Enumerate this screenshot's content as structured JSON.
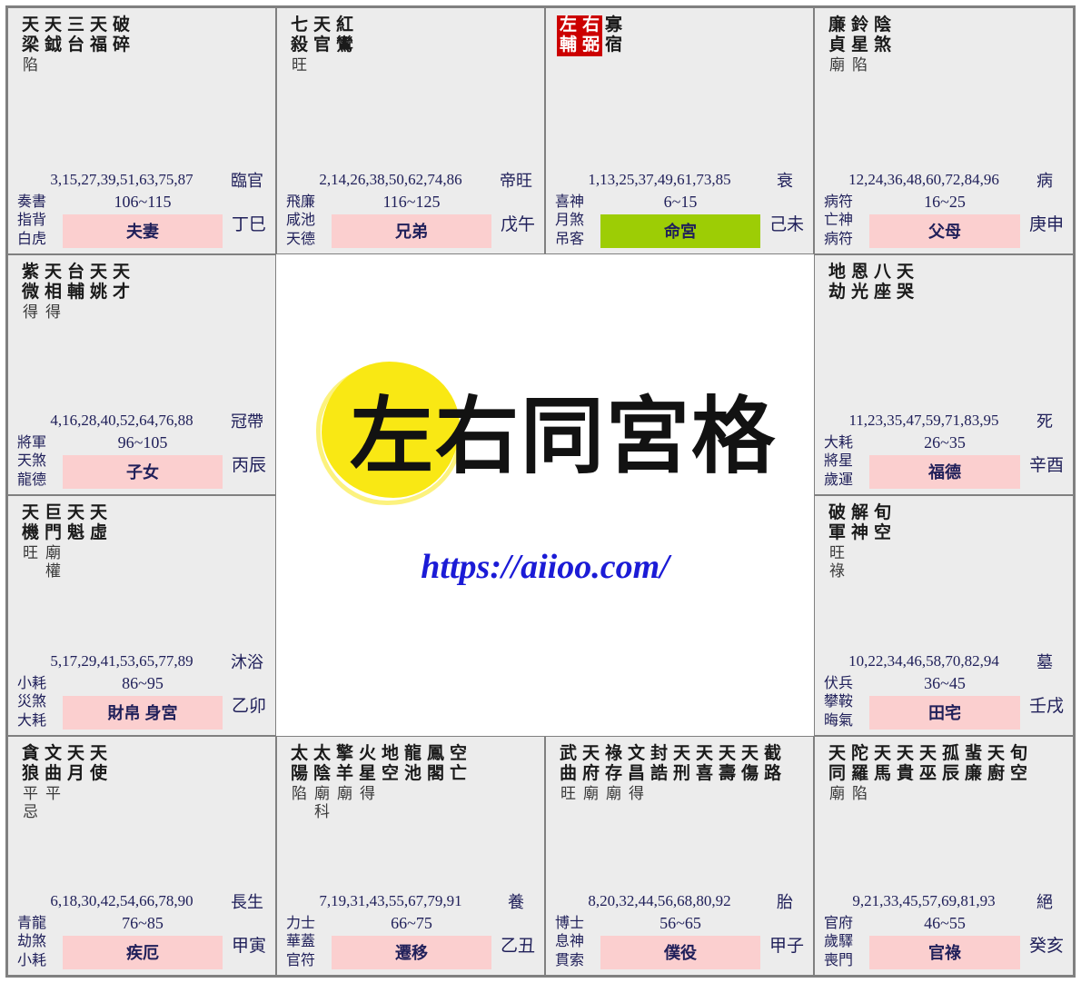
{
  "center": {
    "watermark_text": "左右同宮格",
    "watermark_highlight_char": "左",
    "site_url": "https://aiioo.com/",
    "brush_color": "#f9e814",
    "url_color": "#1b1bd6"
  },
  "theme": {
    "cell_bg": "#ececec",
    "border": "#808080",
    "badge_pink": "#fbcfcf",
    "badge_green": "#9dcd05",
    "star_highlight_red": "#cc0000",
    "text_navy": "#20205a"
  },
  "palaces": [
    {
      "id": "si",
      "grid": {
        "col": 0,
        "row": 0
      },
      "stars": [
        {
          "name": "天梁",
          "highlight": false
        },
        {
          "name": "天鉞",
          "highlight": false
        },
        {
          "name": "三台",
          "highlight": false
        },
        {
          "name": "天福",
          "highlight": false
        },
        {
          "name": "破碎",
          "highlight": false
        }
      ],
      "brightness": [
        "陷"
      ],
      "transforms": [],
      "ages": "3,15,27,39,51,63,75,87",
      "stage": "臨官",
      "gods": [
        "奏書",
        "指背",
        "白虎"
      ],
      "decade": "106~115",
      "palace_name": "夫妻",
      "is_life_palace": false,
      "branch": "丁巳"
    },
    {
      "id": "wu",
      "grid": {
        "col": 1,
        "row": 0
      },
      "stars": [
        {
          "name": "七殺",
          "highlight": false
        },
        {
          "name": "天官",
          "highlight": false
        },
        {
          "name": "紅鸞",
          "highlight": false
        }
      ],
      "brightness": [
        "旺"
      ],
      "transforms": [],
      "ages": "2,14,26,38,50,62,74,86",
      "stage": "帝旺",
      "gods": [
        "飛廉",
        "咸池",
        "天德"
      ],
      "decade": "116~125",
      "palace_name": "兄弟",
      "is_life_palace": false,
      "branch": "戊午"
    },
    {
      "id": "wei",
      "grid": {
        "col": 2,
        "row": 0
      },
      "stars": [
        {
          "name": "左輔",
          "highlight": true
        },
        {
          "name": "右弼",
          "highlight": true
        },
        {
          "name": "寡宿",
          "highlight": false
        }
      ],
      "brightness": [],
      "transforms": [],
      "ages": "1,13,25,37,49,61,73,85",
      "stage": "衰",
      "gods": [
        "喜神",
        "月煞",
        "吊客"
      ],
      "decade": "6~15",
      "palace_name": "命宮",
      "is_life_palace": true,
      "branch": "己未"
    },
    {
      "id": "shen",
      "grid": {
        "col": 3,
        "row": 0
      },
      "stars": [
        {
          "name": "廉貞",
          "highlight": false
        },
        {
          "name": "鈴星",
          "highlight": false
        },
        {
          "name": "陰煞",
          "highlight": false
        }
      ],
      "brightness": [
        "廟",
        "陷"
      ],
      "transforms": [],
      "ages": "12,24,36,48,60,72,84,96",
      "stage": "病",
      "gods": [
        "病符",
        "亡神",
        "病符"
      ],
      "decade": "16~25",
      "palace_name": "父母",
      "is_life_palace": false,
      "branch": "庚申"
    },
    {
      "id": "chen",
      "grid": {
        "col": 0,
        "row": 1
      },
      "stars": [
        {
          "name": "紫微",
          "highlight": false
        },
        {
          "name": "天相",
          "highlight": false
        },
        {
          "name": "台輔",
          "highlight": false
        },
        {
          "name": "天姚",
          "highlight": false
        },
        {
          "name": "天才",
          "highlight": false
        }
      ],
      "brightness": [
        "得",
        "得"
      ],
      "transforms": [],
      "ages": "4,16,28,40,52,64,76,88",
      "stage": "冠帶",
      "gods": [
        "將軍",
        "天煞",
        "龍德"
      ],
      "decade": "96~105",
      "palace_name": "子女",
      "is_life_palace": false,
      "branch": "丙辰"
    },
    {
      "id": "you",
      "grid": {
        "col": 3,
        "row": 1
      },
      "stars": [
        {
          "name": "地劫",
          "highlight": false
        },
        {
          "name": "恩光",
          "highlight": false
        },
        {
          "name": "八座",
          "highlight": false
        },
        {
          "name": "天哭",
          "highlight": false
        }
      ],
      "brightness": [],
      "transforms": [],
      "ages": "11,23,35,47,59,71,83,95",
      "stage": "死",
      "gods": [
        "大耗",
        "將星",
        "歲運"
      ],
      "decade": "26~35",
      "palace_name": "福德",
      "is_life_palace": false,
      "branch": "辛酉"
    },
    {
      "id": "mao",
      "grid": {
        "col": 0,
        "row": 2
      },
      "stars": [
        {
          "name": "天機",
          "highlight": false
        },
        {
          "name": "巨門",
          "highlight": false
        },
        {
          "name": "天魁",
          "highlight": false
        },
        {
          "name": "天虛",
          "highlight": false
        }
      ],
      "brightness": [
        "旺",
        "廟"
      ],
      "transforms": [
        "",
        "權"
      ],
      "ages": "5,17,29,41,53,65,77,89",
      "stage": "沐浴",
      "gods": [
        "小耗",
        "災煞",
        "大耗"
      ],
      "decade": "86~95",
      "palace_name": "財帛 身宮",
      "is_life_palace": false,
      "branch": "乙卯"
    },
    {
      "id": "xu",
      "grid": {
        "col": 3,
        "row": 2
      },
      "stars": [
        {
          "name": "破軍",
          "highlight": false
        },
        {
          "name": "解神",
          "highlight": false
        },
        {
          "name": "旬空",
          "highlight": false
        }
      ],
      "brightness": [
        "旺"
      ],
      "transforms": [
        "祿"
      ],
      "ages": "10,22,34,46,58,70,82,94",
      "stage": "墓",
      "gods": [
        "伏兵",
        "攀鞍",
        "晦氣"
      ],
      "decade": "36~45",
      "palace_name": "田宅",
      "is_life_palace": false,
      "branch": "壬戌"
    },
    {
      "id": "yin",
      "grid": {
        "col": 0,
        "row": 3
      },
      "stars": [
        {
          "name": "貪狼",
          "highlight": false
        },
        {
          "name": "文曲",
          "highlight": false
        },
        {
          "name": "天月",
          "highlight": false
        },
        {
          "name": "天使",
          "highlight": false
        }
      ],
      "brightness": [
        "平",
        "平"
      ],
      "transforms": [
        "忌"
      ],
      "ages": "6,18,30,42,54,66,78,90",
      "stage": "長生",
      "gods": [
        "青龍",
        "劫煞",
        "小耗"
      ],
      "decade": "76~85",
      "palace_name": "疾厄",
      "is_life_palace": false,
      "branch": "甲寅"
    },
    {
      "id": "chou",
      "grid": {
        "col": 1,
        "row": 3
      },
      "stars": [
        {
          "name": "太陽",
          "highlight": false
        },
        {
          "name": "太陰",
          "highlight": false
        },
        {
          "name": "擎羊",
          "highlight": false
        },
        {
          "name": "火星",
          "highlight": false
        },
        {
          "name": "地空",
          "highlight": false
        },
        {
          "name": "龍池",
          "highlight": false
        },
        {
          "name": "鳳閣",
          "highlight": false
        },
        {
          "name": "空亡",
          "highlight": false
        }
      ],
      "brightness": [
        "陷",
        "廟",
        "廟",
        "得"
      ],
      "transforms": [
        "",
        "科"
      ],
      "ages": "7,19,31,43,55,67,79,91",
      "stage": "養",
      "gods": [
        "力士",
        "華蓋",
        "官符"
      ],
      "decade": "66~75",
      "palace_name": "遷移",
      "is_life_palace": false,
      "branch": "乙丑"
    },
    {
      "id": "zi",
      "grid": {
        "col": 2,
        "row": 3
      },
      "stars": [
        {
          "name": "武曲",
          "highlight": false
        },
        {
          "name": "天府",
          "highlight": false
        },
        {
          "name": "祿存",
          "highlight": false
        },
        {
          "name": "文昌",
          "highlight": false
        },
        {
          "name": "封誥",
          "highlight": false
        },
        {
          "name": "天刑",
          "highlight": false
        },
        {
          "name": "天喜",
          "highlight": false
        },
        {
          "name": "天壽",
          "highlight": false
        },
        {
          "name": "天傷",
          "highlight": false
        },
        {
          "name": "截路",
          "highlight": false
        }
      ],
      "brightness": [
        "旺",
        "廟",
        "廟",
        "得"
      ],
      "transforms": [],
      "ages": "8,20,32,44,56,68,80,92",
      "stage": "胎",
      "gods": [
        "博士",
        "息神",
        "貫索"
      ],
      "decade": "56~65",
      "palace_name": "僕役",
      "is_life_palace": false,
      "branch": "甲子"
    },
    {
      "id": "hai",
      "grid": {
        "col": 3,
        "row": 3
      },
      "stars": [
        {
          "name": "天同",
          "highlight": false
        },
        {
          "name": "陀羅",
          "highlight": false
        },
        {
          "name": "天馬",
          "highlight": false
        },
        {
          "name": "天貴",
          "highlight": false
        },
        {
          "name": "天巫",
          "highlight": false
        },
        {
          "name": "孤辰",
          "highlight": false
        },
        {
          "name": "蜚廉",
          "highlight": false
        },
        {
          "name": "天廚",
          "highlight": false
        },
        {
          "name": "旬空",
          "highlight": false
        }
      ],
      "brightness": [
        "廟",
        "陷"
      ],
      "transforms": [],
      "ages": "9,21,33,45,57,69,81,93",
      "stage": "絕",
      "gods": [
        "官府",
        "歲驛",
        "喪門"
      ],
      "decade": "46~55",
      "palace_name": "官祿",
      "is_life_palace": false,
      "branch": "癸亥"
    }
  ]
}
